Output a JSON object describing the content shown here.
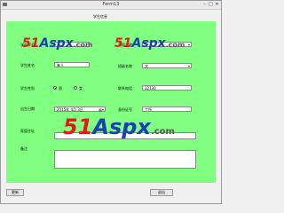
{
  "window": {
    "title": "Form13"
  },
  "header": {
    "title": "学生信息"
  },
  "labels": {
    "student_id": "学生学号",
    "student_name": "学生姓名",
    "gender": "学生性别",
    "birth_date": "出生日期",
    "home_address": "家庭住址",
    "notes": "备注",
    "department": "系部名称",
    "class_name": "班级名称",
    "phone": "联系电话",
    "id_card": "身份证号"
  },
  "fields": {
    "student_id": "123",
    "student_name": "笨儿",
    "birth_date": "2015年 4月 3日",
    "phone": "32130",
    "id_card": "工所",
    "department": "",
    "class_name": "文"
  },
  "gender_options": {
    "male": "男",
    "female": "女",
    "selected": "male"
  },
  "buttons": {
    "update": "更新",
    "exit": "退出"
  },
  "watermark": {
    "brand_a": "51",
    "brand_b": "Aspx",
    "domain": ".com"
  }
}
